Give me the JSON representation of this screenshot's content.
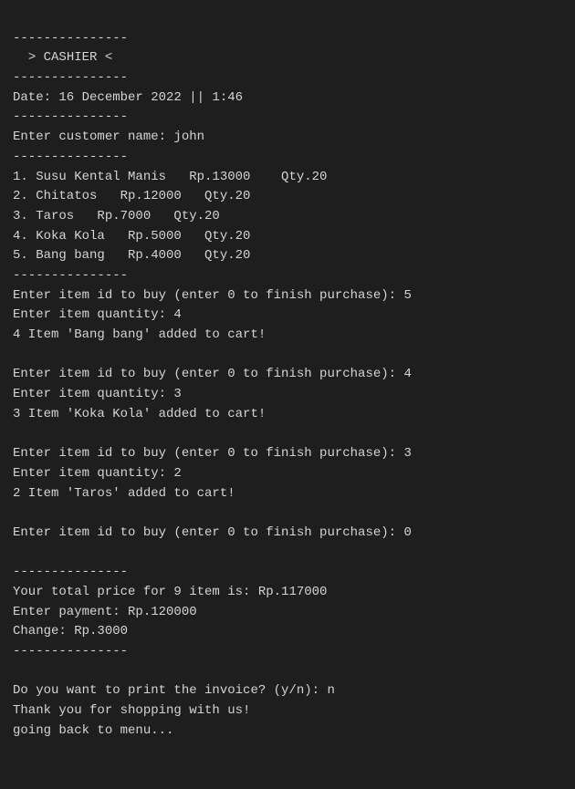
{
  "terminal": {
    "lines": [
      "---------------",
      "  > CASHIER <",
      "---------------",
      "Date: 16 December 2022 || 1:46",
      "---------------",
      "Enter customer name: john",
      "---------------",
      "1. Susu Kental Manis   Rp.13000    Qty.20",
      "2. Chitatos   Rp.12000   Qty.20",
      "3. Taros   Rp.7000   Qty.20",
      "4. Koka Kola   Rp.5000   Qty.20",
      "5. Bang bang   Rp.4000   Qty.20",
      "---------------",
      "Enter item id to buy (enter 0 to finish purchase): 5",
      "Enter item quantity: 4",
      "4 Item 'Bang bang' added to cart!",
      "",
      "Enter item id to buy (enter 0 to finish purchase): 4",
      "Enter item quantity: 3",
      "3 Item 'Koka Kola' added to cart!",
      "",
      "Enter item id to buy (enter 0 to finish purchase): 3",
      "Enter item quantity: 2",
      "2 Item 'Taros' added to cart!",
      "",
      "Enter item id to buy (enter 0 to finish purchase): 0",
      "",
      "---------------",
      "Your total price for 9 item is: Rp.117000",
      "Enter payment: Rp.120000",
      "Change: Rp.3000",
      "---------------",
      "",
      "Do you want to print the invoice? (y/n): n",
      "Thank you for shopping with us!",
      "going back to menu..."
    ]
  }
}
